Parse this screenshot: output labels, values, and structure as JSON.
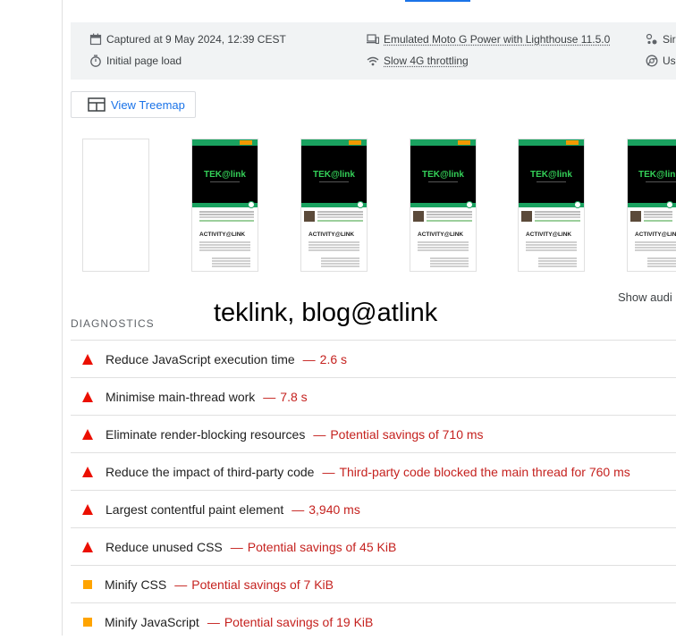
{
  "runtime": {
    "captured": "Captured at 9 May 2024, 12:39 CEST",
    "load_type": "Initial page load",
    "device": "Emulated Moto G Power with Lighthouse 11.5.0",
    "throttling": "Slow 4G throttling",
    "right_top": "Sir",
    "right_bottom": "Us"
  },
  "treemap": {
    "label": "View Treemap"
  },
  "filmstrip": {
    "logo": "TEK@link",
    "section_heading": "ACTIVITY@LINK"
  },
  "show_audits": "Show audi",
  "overlay_caption": "teklink, blog@atlink",
  "diagnostics": {
    "title": "DIAGNOSTICS",
    "items": [
      {
        "severity": "fail",
        "title": "Reduce JavaScript execution time",
        "value": "2.6 s"
      },
      {
        "severity": "fail",
        "title": "Minimise main-thread work",
        "value": "7.8 s"
      },
      {
        "severity": "fail",
        "title": "Eliminate render-blocking resources",
        "value": "Potential savings of 710 ms"
      },
      {
        "severity": "fail",
        "title": "Reduce the impact of third-party code",
        "value": "Third-party code blocked the main thread for 760 ms"
      },
      {
        "severity": "fail",
        "title": "Largest contentful paint element",
        "value": "3,940 ms"
      },
      {
        "severity": "fail",
        "title": "Reduce unused CSS",
        "value": "Potential savings of 45 KiB"
      },
      {
        "severity": "average",
        "title": "Minify CSS",
        "value": "Potential savings of 7 KiB"
      },
      {
        "severity": "average",
        "title": "Minify JavaScript",
        "value": "Potential savings of 19 KiB"
      }
    ],
    "separator": "—"
  },
  "colors": {
    "fail": "#eb0f00",
    "average": "#ffa400",
    "link": "#1a73e8",
    "value": "#c5221f"
  }
}
